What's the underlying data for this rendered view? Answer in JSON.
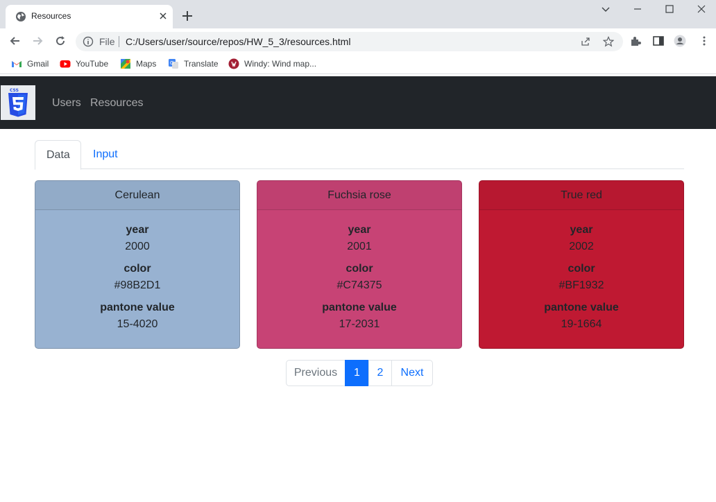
{
  "browser": {
    "tab_title": "Resources",
    "omnibox_prefix": "File",
    "url": "C:/Users/user/source/repos/HW_5_3/resources.html",
    "bookmarks": [
      {
        "label": "Gmail",
        "icon": "gmail-icon"
      },
      {
        "label": "YouTube",
        "icon": "youtube-icon"
      },
      {
        "label": "Maps",
        "icon": "maps-icon"
      },
      {
        "label": "Translate",
        "icon": "translate-icon"
      },
      {
        "label": "Windy: Wind map...",
        "icon": "windy-icon"
      }
    ]
  },
  "navbar": {
    "brand_icon": "css3-logo",
    "links": [
      {
        "label": "Users"
      },
      {
        "label": "Resources"
      }
    ]
  },
  "tabs": [
    {
      "label": "Data",
      "active": true
    },
    {
      "label": "Input",
      "active": false
    }
  ],
  "cards": [
    {
      "name": "Cerulean",
      "bg": "#98B2D1",
      "fields": {
        "year_label": "year",
        "year": "2000",
        "color_label": "color",
        "color": "#98B2D1",
        "pantone_label": "pantone value",
        "pantone": "15-4020"
      }
    },
    {
      "name": "Fuchsia rose",
      "bg": "#C74375",
      "fields": {
        "year_label": "year",
        "year": "2001",
        "color_label": "color",
        "color": "#C74375",
        "pantone_label": "pantone value",
        "pantone": "17-2031"
      }
    },
    {
      "name": "True red",
      "bg": "#BF1932",
      "fields": {
        "year_label": "year",
        "year": "2002",
        "color_label": "color",
        "color": "#BF1932",
        "pantone_label": "pantone value",
        "pantone": "19-1664"
      }
    }
  ],
  "pagination": {
    "previous": "Previous",
    "pages": [
      "1",
      "2"
    ],
    "current": "1",
    "next": "Next"
  },
  "colors": {
    "navbar_bg": "#212529",
    "link_primary": "#0d6efd"
  }
}
